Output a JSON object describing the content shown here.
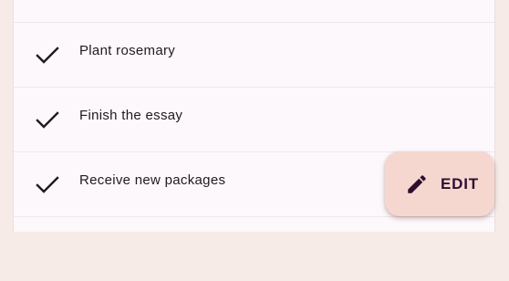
{
  "tasks": [
    {
      "label": "Plant rosemary",
      "icon": "check-icon"
    },
    {
      "label": "Finish the essay",
      "icon": "check-icon"
    },
    {
      "label": "Receive new packages",
      "icon": "check-icon"
    }
  ],
  "fab": {
    "label": "EDIT",
    "icon": "edit-pencil-icon"
  },
  "colors": {
    "background": "#f7ebe7",
    "surface": "#fdf8fb",
    "fab_container": "#f6d7cf",
    "fab_content": "#2e0f30",
    "text": "#1f1b1e"
  }
}
